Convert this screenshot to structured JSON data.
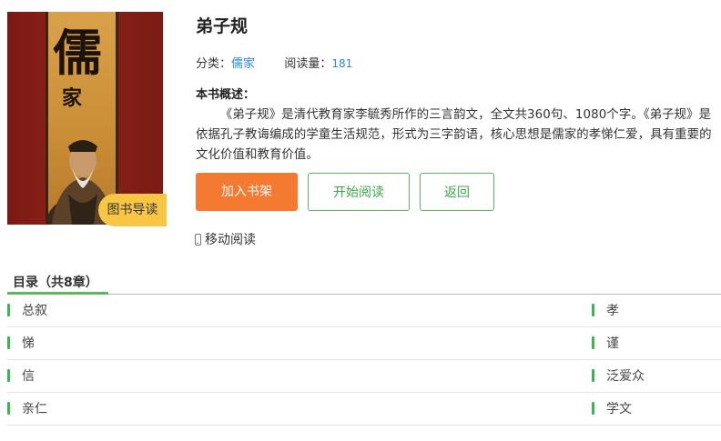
{
  "book": {
    "cover_chars": {
      "big": "儒",
      "small": "家"
    },
    "badge": "图书导读",
    "title": "弟子规",
    "category_label": "分类：",
    "category": "儒家",
    "reads_label": "阅读量：",
    "reads": "181",
    "summary_heading": "本书概述：",
    "summary": "《弟子规》是清代教育家李毓秀所作的三言韵文，全文共360句、1080个字。《弟子规》是依据孔子教诲编成的学童生活规范，形式为三字韵语，核心思想是儒家的孝悌仁爱，具有重要的文化价值和教育价值。"
  },
  "buttons": {
    "add_shelf": "加入书架",
    "start_read": "开始阅读",
    "back": "返回"
  },
  "mobile_read": "移动阅读",
  "toc": {
    "heading": "目录（共8章）",
    "rows": [
      {
        "left": "总叙",
        "right": "孝"
      },
      {
        "left": "悌",
        "right": "谨"
      },
      {
        "left": "信",
        "right": "泛爱众"
      },
      {
        "left": "亲仁",
        "right": "学文"
      }
    ]
  },
  "colors": {
    "accent_orange": "#f47a32",
    "accent_green": "#5cb85c",
    "link_blue": "#2b8ad3",
    "badge_yellow": "#f7c744"
  }
}
